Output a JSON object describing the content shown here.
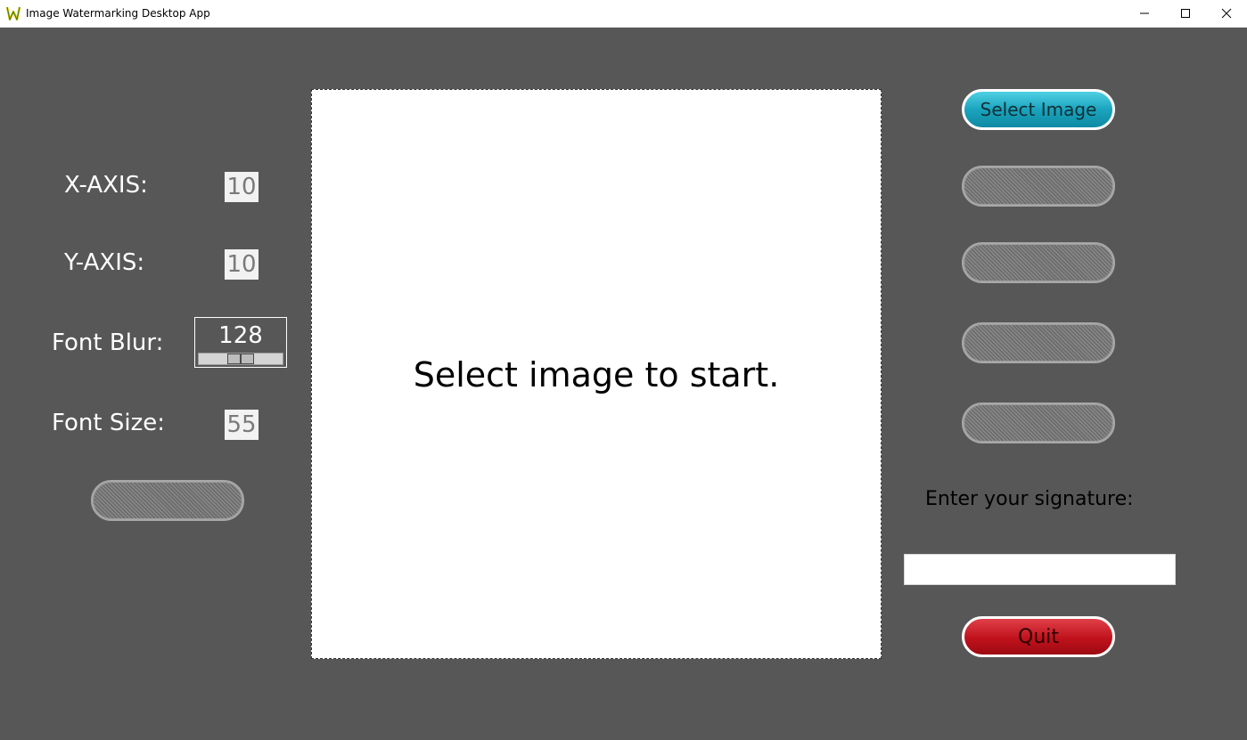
{
  "window": {
    "title": "Image Watermarking Desktop App"
  },
  "icons": {
    "app": "w-logo-icon",
    "minimize": "minimize-icon",
    "maximize": "maximize-icon",
    "close": "close-icon"
  },
  "left_panel": {
    "x_axis_label": "X-AXIS:",
    "x_axis_value": "10",
    "y_axis_label": "Y-AXIS:",
    "y_axis_value": "10",
    "font_blur_label": "Font Blur:",
    "font_blur_value": "128",
    "font_blur_min": 0,
    "font_blur_max": 255,
    "font_size_label": "Font Size:",
    "font_size_value": "55",
    "apply_button_label": ""
  },
  "canvas": {
    "prompt": "Select image to start."
  },
  "right_panel": {
    "select_image_label": "Select Image",
    "button_2_label": "",
    "button_3_label": "",
    "button_4_label": "",
    "button_5_label": "",
    "signature_label": "Enter your signature:",
    "signature_value": "",
    "quit_label": "Quit"
  },
  "colors": {
    "background": "#575757",
    "primary_button": "#1ba3bd",
    "quit_button": "#c0121c"
  }
}
